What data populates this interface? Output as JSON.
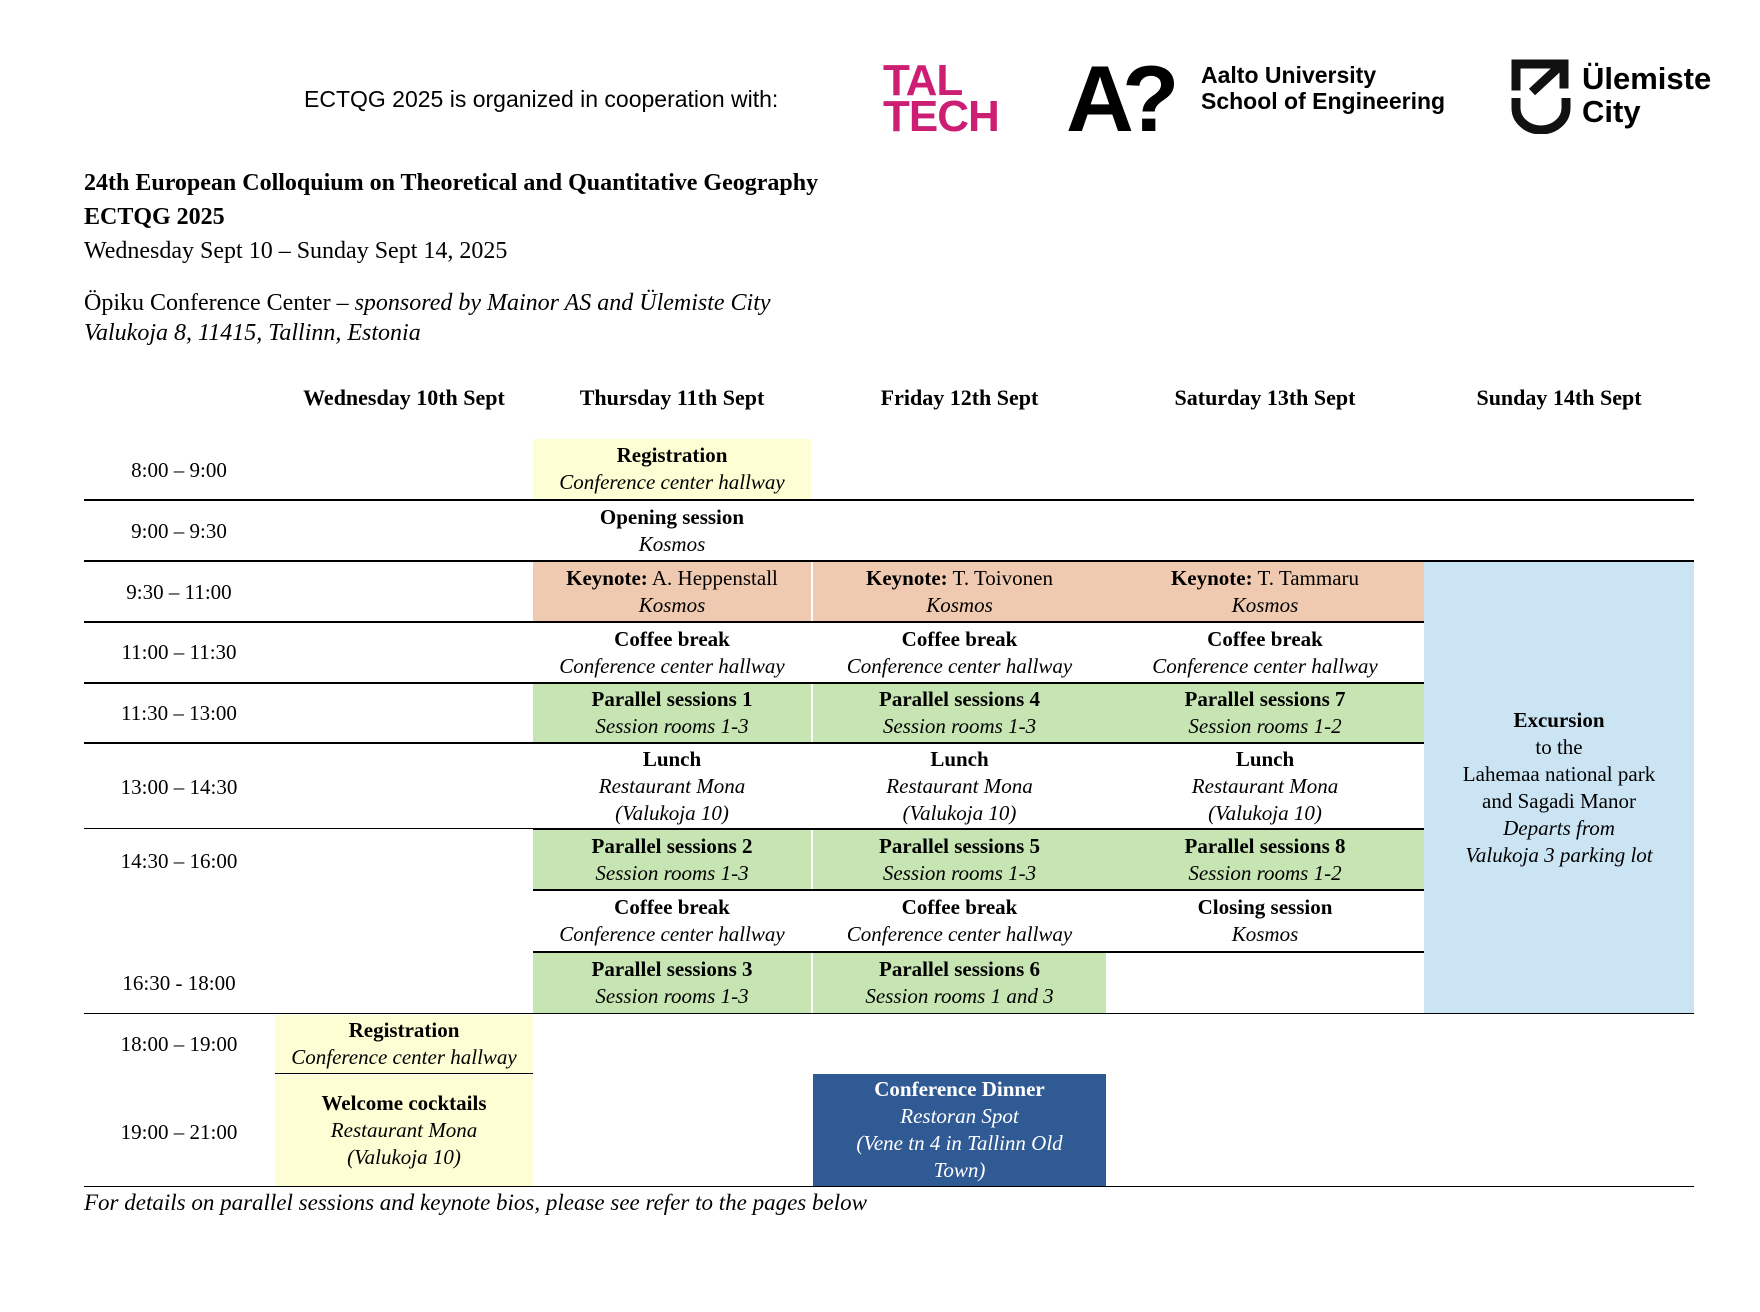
{
  "header": {
    "cooperation_text": "ECTQG 2025 is organized in cooperation with:",
    "logos": {
      "taltech": [
        "TAL",
        "TECH"
      ],
      "aalto_mark": [
        "A",
        "?"
      ],
      "aalto_lines": [
        "Aalto University",
        "School of Engineering"
      ],
      "ulemiste_lines": [
        "Ülemiste",
        "City"
      ]
    }
  },
  "event": {
    "title_line1": "24th European Colloquium on Theoretical and Quantitative Geography",
    "title_line2": "ECTQG 2025",
    "dates": "Wednesday Sept 10 – Sunday Sept 14, 2025",
    "venue_name": "Öpiku Conference Center –",
    "venue_sponsor": "sponsored by Mainor AS and Ülemiste City",
    "address": "Valukoja 8, 11415, Tallinn, Estonia"
  },
  "schedule": {
    "days": [
      "Wednesday 10th Sept",
      "Thursday 11th Sept",
      "Friday 12th Sept",
      "Saturday 13th Sept",
      "Sunday 14th Sept"
    ],
    "times": [
      "8:00 – 9:00",
      "9:00 – 9:30",
      "9:30 – 11:00",
      "11:00 – 11:30",
      "11:30 – 13:00",
      "13:00 – 14:30",
      "14:30 – 16:00",
      "16:30 - 18:00",
      "18:00 – 19:00",
      "19:00 – 21:00"
    ],
    "thu": {
      "registration": {
        "title": "Registration",
        "venue": "Conference center hallway"
      },
      "opening": {
        "title": "Opening session",
        "venue": "Kosmos"
      },
      "keynote": {
        "label": "Keynote:",
        "speaker": " A. Heppenstall",
        "venue": "Kosmos"
      },
      "coffee1": {
        "title": "Coffee break",
        "venue": "Conference center hallway"
      },
      "parallel1": {
        "title": "Parallel sessions 1",
        "venue": "Session rooms 1-3"
      },
      "lunch": {
        "title": "Lunch",
        "venue1": "Restaurant Mona",
        "venue2": "(Valukoja 10)"
      },
      "parallel2": {
        "title": "Parallel sessions 2",
        "venue": "Session rooms 1-3"
      },
      "coffee2": {
        "title": "Coffee break",
        "venue": "Conference center hallway"
      },
      "parallel3": {
        "title": "Parallel sessions 3",
        "venue": "Session rooms 1-3"
      }
    },
    "fri": {
      "keynote": {
        "label": "Keynote:",
        "speaker": " T. Toivonen",
        "venue": "Kosmos"
      },
      "coffee1": {
        "title": "Coffee break",
        "venue": "Conference center hallway"
      },
      "parallel4": {
        "title": "Parallel sessions 4",
        "venue": "Session rooms 1-3"
      },
      "lunch": {
        "title": "Lunch",
        "venue1": "Restaurant Mona",
        "venue2": "(Valukoja 10)"
      },
      "parallel5": {
        "title": "Parallel sessions 5",
        "venue": "Session rooms 1-3"
      },
      "coffee2": {
        "title": "Coffee break",
        "venue": "Conference center hallway"
      },
      "parallel6": {
        "title": "Parallel sessions 6",
        "venue": "Session rooms 1 and 3"
      },
      "dinner": {
        "title": "Conference Dinner",
        "venue1": "Restoran Spot",
        "venue2": "(Vene tn 4 in Tallinn Old",
        "venue3": "Town)"
      }
    },
    "sat": {
      "keynote": {
        "label": "Keynote:",
        "speaker": " T. Tammaru",
        "venue": "Kosmos"
      },
      "coffee": {
        "title": "Coffee break",
        "venue": "Conference center hallway"
      },
      "parallel7": {
        "title": "Parallel sessions 7",
        "venue": "Session rooms 1-2"
      },
      "lunch": {
        "title": "Lunch",
        "venue1": "Restaurant Mona",
        "venue2": "(Valukoja 10)"
      },
      "parallel8": {
        "title": "Parallel sessions 8",
        "venue": "Session rooms 1-2"
      },
      "closing": {
        "title": "Closing session",
        "venue": "Kosmos"
      }
    },
    "wed": {
      "registration": {
        "title": "Registration",
        "venue": "Conference center hallway"
      },
      "welcome": {
        "title": "Welcome cocktails",
        "venue1": "Restaurant Mona",
        "venue2": "(Valukoja 10)"
      }
    },
    "sun": {
      "excursion": {
        "title": "Excursion",
        "line1": "to the",
        "line2": "Lahemaa national park",
        "line3": "and Sagadi Manor",
        "line4": "Departs from",
        "line5": "Valukoja 3 parking lot"
      }
    }
  },
  "footnote": "For details on parallel sessions and keynote bios, please see refer to the pages below",
  "colors": {
    "registration_yellow": "#fefed4",
    "keynote_orange": "#f0cab0",
    "parallel_green": "#c6e5b2",
    "excursion_blue": "#cbe4f4",
    "dinner_navy": "#305a94",
    "taltech_magenta": "#cc1f73"
  }
}
